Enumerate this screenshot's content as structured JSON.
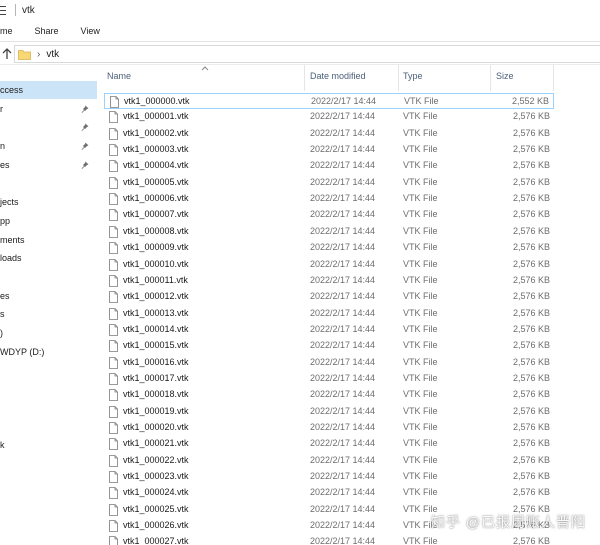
{
  "window": {
    "title": "vtk"
  },
  "ribbon": {
    "tabs": [
      "me",
      "Share",
      "View"
    ]
  },
  "address": {
    "path": "vtk",
    "separator": "›"
  },
  "sidebar": {
    "items": [
      {
        "label": "ccess",
        "selected": true,
        "pinned": false
      },
      {
        "label": "r",
        "selected": false,
        "pinned": true
      },
      {
        "label": "",
        "selected": false,
        "pinned": true
      },
      {
        "label": "n",
        "selected": false,
        "pinned": true
      },
      {
        "label": "es",
        "selected": false,
        "pinned": true
      },
      {
        "label": "",
        "selected": false,
        "pinned": false
      },
      {
        "label": "jects",
        "selected": false,
        "pinned": false
      },
      {
        "label": "pp",
        "selected": false,
        "pinned": false
      },
      {
        "label": "ments",
        "selected": false,
        "pinned": false
      },
      {
        "label": "loads",
        "selected": false,
        "pinned": false
      },
      {
        "label": "",
        "selected": false,
        "pinned": false
      },
      {
        "label": "es",
        "selected": false,
        "pinned": false
      },
      {
        "label": "s",
        "selected": false,
        "pinned": false
      },
      {
        "label": ")",
        "selected": false,
        "pinned": false
      },
      {
        "label": "WDYP (D:)",
        "selected": false,
        "pinned": false
      },
      {
        "label": "",
        "selected": false,
        "pinned": false
      },
      {
        "label": "",
        "selected": false,
        "pinned": false
      },
      {
        "label": "",
        "selected": false,
        "pinned": false
      },
      {
        "label": "",
        "selected": false,
        "pinned": false
      },
      {
        "label": "k",
        "selected": false,
        "pinned": false
      }
    ]
  },
  "columns": {
    "name": "Name",
    "date": "Date modified",
    "type": "Type",
    "size": "Size"
  },
  "files": [
    {
      "name": "vtk1_000000.vtk",
      "date": "2022/2/17 14:44",
      "type": "VTK File",
      "size": "2,552 KB"
    },
    {
      "name": "vtk1_000001.vtk",
      "date": "2022/2/17 14:44",
      "type": "VTK File",
      "size": "2,576 KB"
    },
    {
      "name": "vtk1_000002.vtk",
      "date": "2022/2/17 14:44",
      "type": "VTK File",
      "size": "2,576 KB"
    },
    {
      "name": "vtk1_000003.vtk",
      "date": "2022/2/17 14:44",
      "type": "VTK File",
      "size": "2,576 KB"
    },
    {
      "name": "vtk1_000004.vtk",
      "date": "2022/2/17 14:44",
      "type": "VTK File",
      "size": "2,576 KB"
    },
    {
      "name": "vtk1_000005.vtk",
      "date": "2022/2/17 14:44",
      "type": "VTK File",
      "size": "2,576 KB"
    },
    {
      "name": "vtk1_000006.vtk",
      "date": "2022/2/17 14:44",
      "type": "VTK File",
      "size": "2,576 KB"
    },
    {
      "name": "vtk1_000007.vtk",
      "date": "2022/2/17 14:44",
      "type": "VTK File",
      "size": "2,576 KB"
    },
    {
      "name": "vtk1_000008.vtk",
      "date": "2022/2/17 14:44",
      "type": "VTK File",
      "size": "2,576 KB"
    },
    {
      "name": "vtk1_000009.vtk",
      "date": "2022/2/17 14:44",
      "type": "VTK File",
      "size": "2,576 KB"
    },
    {
      "name": "vtk1_000010.vtk",
      "date": "2022/2/17 14:44",
      "type": "VTK File",
      "size": "2,576 KB"
    },
    {
      "name": "vtk1_000011.vtk",
      "date": "2022/2/17 14:44",
      "type": "VTK File",
      "size": "2,576 KB"
    },
    {
      "name": "vtk1_000012.vtk",
      "date": "2022/2/17 14:44",
      "type": "VTK File",
      "size": "2,576 KB"
    },
    {
      "name": "vtk1_000013.vtk",
      "date": "2022/2/17 14:44",
      "type": "VTK File",
      "size": "2,576 KB"
    },
    {
      "name": "vtk1_000014.vtk",
      "date": "2022/2/17 14:44",
      "type": "VTK File",
      "size": "2,576 KB"
    },
    {
      "name": "vtk1_000015.vtk",
      "date": "2022/2/17 14:44",
      "type": "VTK File",
      "size": "2,576 KB"
    },
    {
      "name": "vtk1_000016.vtk",
      "date": "2022/2/17 14:44",
      "type": "VTK File",
      "size": "2,576 KB"
    },
    {
      "name": "vtk1_000017.vtk",
      "date": "2022/2/17 14:44",
      "type": "VTK File",
      "size": "2,576 KB"
    },
    {
      "name": "vtk1_000018.vtk",
      "date": "2022/2/17 14:44",
      "type": "VTK File",
      "size": "2,576 KB"
    },
    {
      "name": "vtk1_000019.vtk",
      "date": "2022/2/17 14:44",
      "type": "VTK File",
      "size": "2,576 KB"
    },
    {
      "name": "vtk1_000020.vtk",
      "date": "2022/2/17 14:44",
      "type": "VTK File",
      "size": "2,576 KB"
    },
    {
      "name": "vtk1_000021.vtk",
      "date": "2022/2/17 14:44",
      "type": "VTK File",
      "size": "2,576 KB"
    },
    {
      "name": "vtk1_000022.vtk",
      "date": "2022/2/17 14:44",
      "type": "VTK File",
      "size": "2,576 KB"
    },
    {
      "name": "vtk1_000023.vtk",
      "date": "2022/2/17 14:44",
      "type": "VTK File",
      "size": "2,576 KB"
    },
    {
      "name": "vtk1_000024.vtk",
      "date": "2022/2/17 14:44",
      "type": "VTK File",
      "size": "2,576 KB"
    },
    {
      "name": "vtk1_000025.vtk",
      "date": "2022/2/17 14:44",
      "type": "VTK File",
      "size": "2,576 KB"
    },
    {
      "name": "vtk1_000026.vtk",
      "date": "2022/2/17 14:44",
      "type": "VTK File",
      "size": "2,576 KB"
    },
    {
      "name": "vtk1_000027.vtk",
      "date": "2022/2/17 14:44",
      "type": "VTK File",
      "size": "2,576 KB"
    }
  ],
  "watermark": "知乎 @已报周账人晋阳",
  "colors": {
    "selection": "#cce4f7",
    "focus_border": "#99d1ff",
    "header_text": "#4c607a",
    "folder": "#f8d775"
  }
}
